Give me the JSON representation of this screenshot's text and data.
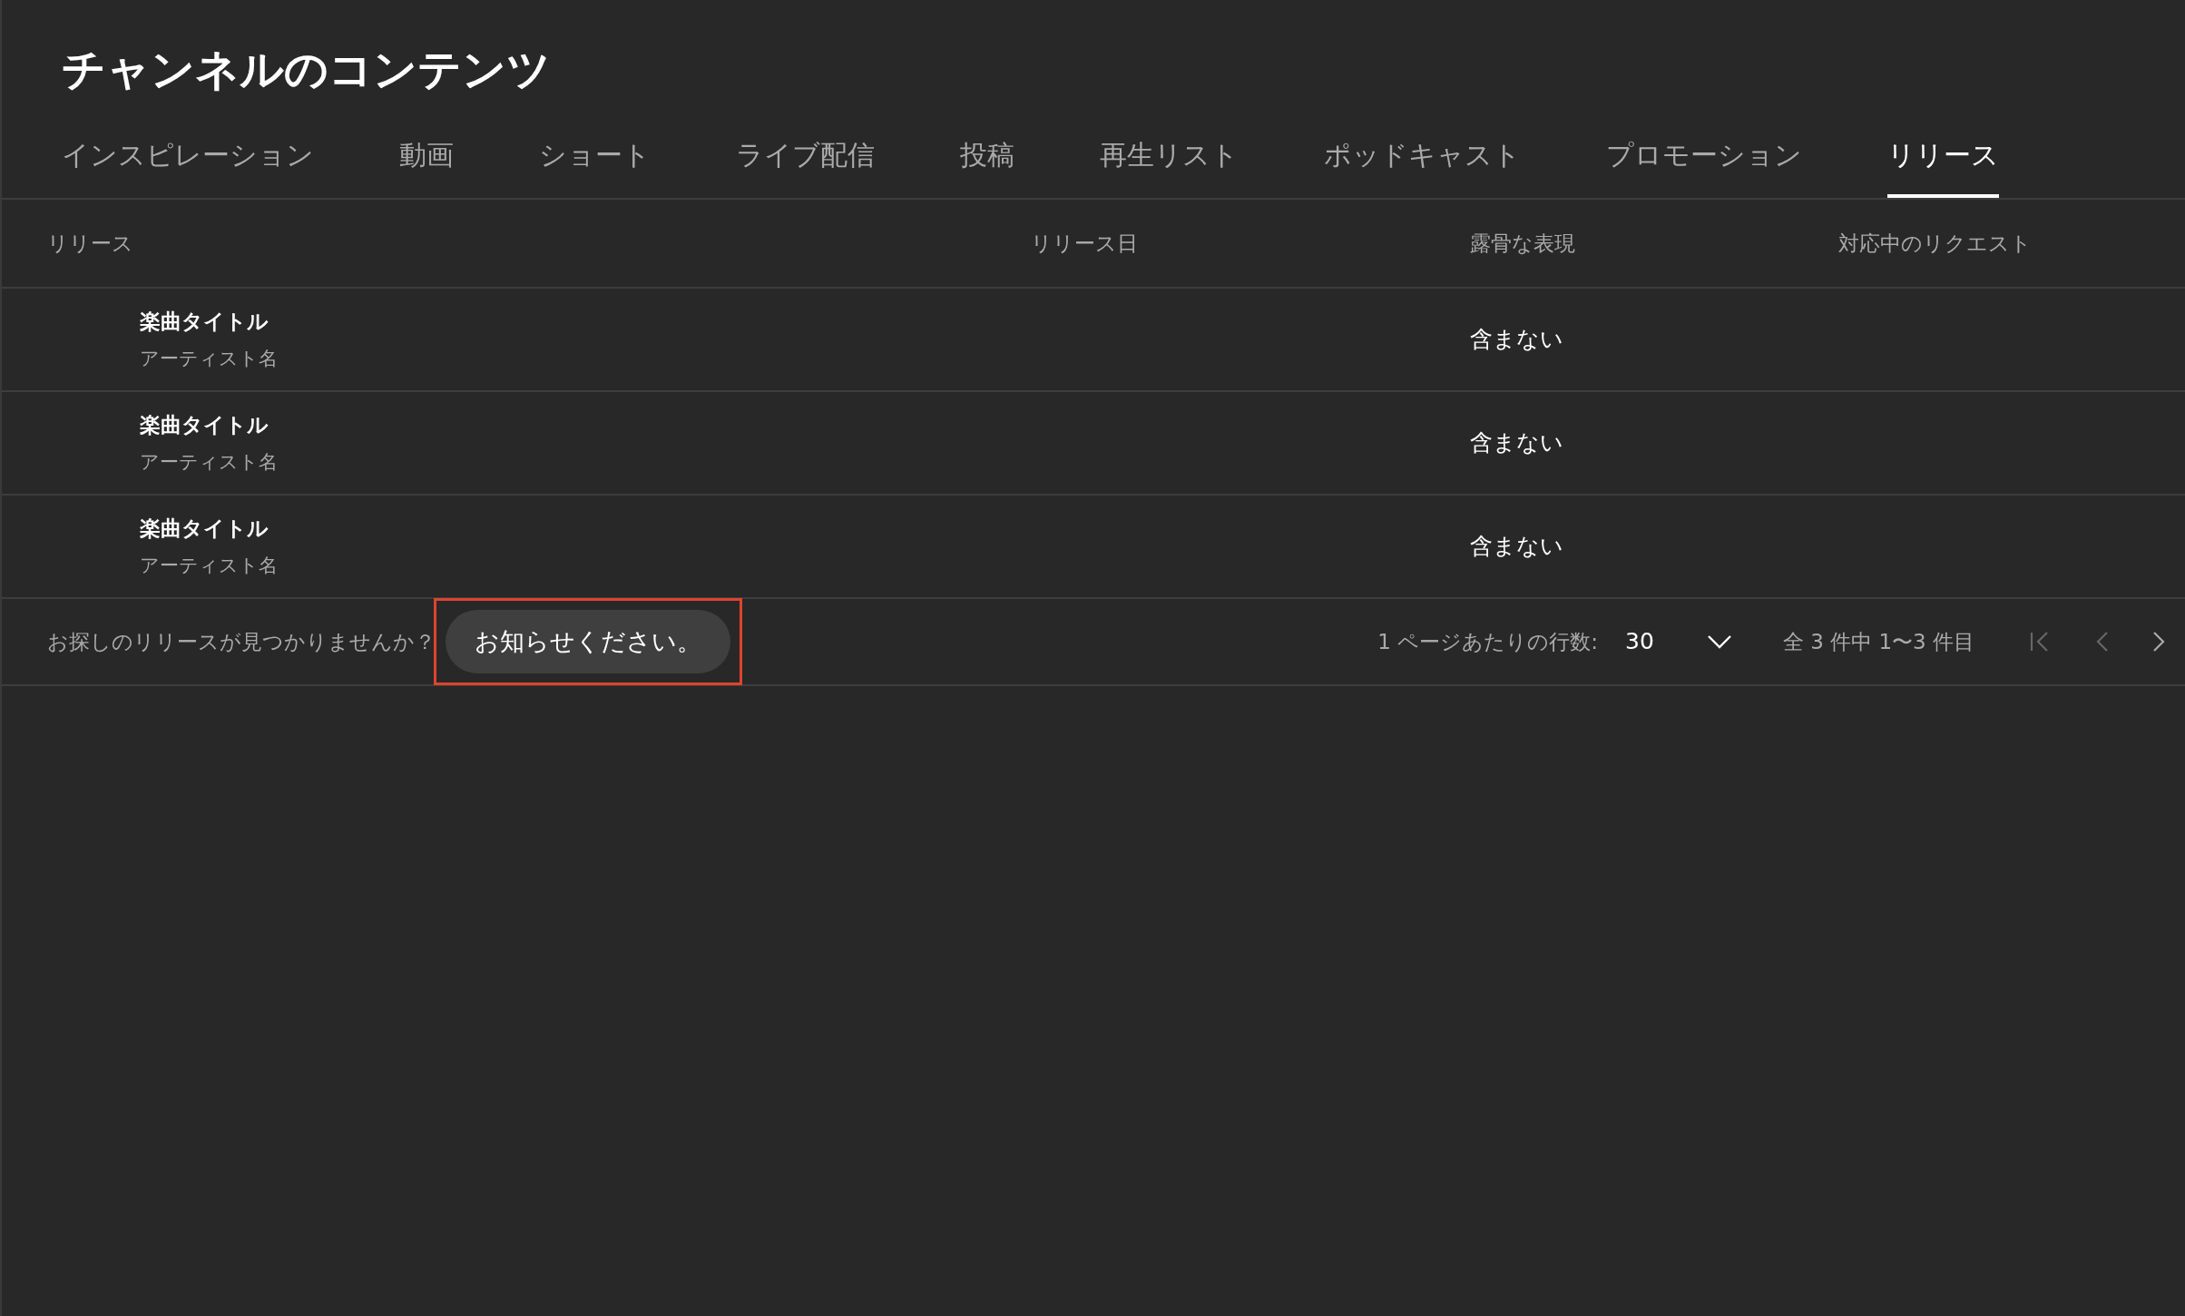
{
  "page": {
    "title": "チャンネルのコンテンツ"
  },
  "tabs": [
    {
      "label": "インスピレーション",
      "selected": false
    },
    {
      "label": "動画",
      "selected": false
    },
    {
      "label": "ショート",
      "selected": false
    },
    {
      "label": "ライブ配信",
      "selected": false
    },
    {
      "label": "投稿",
      "selected": false
    },
    {
      "label": "再生リスト",
      "selected": false
    },
    {
      "label": "ポッドキャスト",
      "selected": false
    },
    {
      "label": "プロモーション",
      "selected": false
    },
    {
      "label": "リリース",
      "selected": true
    }
  ],
  "table": {
    "columns": [
      "リリース",
      "リリース日",
      "露骨な表現",
      "対応中のリクエスト"
    ],
    "rows": [
      {
        "title": "楽曲タイトル",
        "artist": "アーティスト名",
        "explicit": "含まない"
      },
      {
        "title": "楽曲タイトル",
        "artist": "アーティスト名",
        "explicit": "含まない"
      },
      {
        "title": "楽曲タイトル",
        "artist": "アーティスト名",
        "explicit": "含まない"
      }
    ]
  },
  "footer": {
    "prompt": "お探しのリリースが見つかりませんか？",
    "button": {
      "label": "お知らせください。",
      "highlighted": true
    },
    "rows_per_page_label": "1 ページあたりの行数:",
    "rows_per_page": "30",
    "range": "全 3 件中 1〜3 件目",
    "nav": [
      {
        "kind": "first",
        "disabled": true
      },
      {
        "kind": "prev",
        "disabled": true
      },
      {
        "kind": "next",
        "disabled": false
      }
    ]
  }
}
